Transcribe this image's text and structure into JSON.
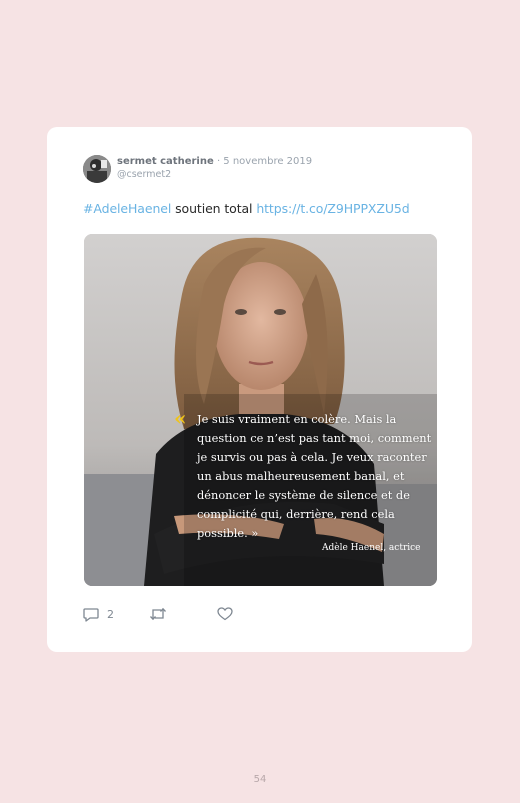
{
  "tweet": {
    "user_name": "sermet catherine",
    "date": "5 novembre 2019",
    "handle": "@csermet2",
    "hashtag": "#AdeleHaenel",
    "text": "soutien total",
    "link": "https://t.co/Z9HPPXZU5d",
    "image_quote": "Je suis vraiment en colère. Mais la question ce n’est pas tant moi, comment je survis ou pas à cela. Je veux raconter un abus malheureusement banal, et dénoncer le système de silence et de complicité qui, derrière, rend cela possible. »",
    "image_quote_mark": "«",
    "image_credit": "Adèle Haenel, actrice",
    "actions": {
      "reply_count": "2",
      "reply_icon": "reply-icon",
      "retweet_icon": "retweet-icon",
      "like_icon": "heart-icon"
    }
  },
  "page_number": "54",
  "colors": {
    "page_background": "#f6e3e4",
    "link": "#69b3e3",
    "quote_accent": "#f0c419"
  }
}
